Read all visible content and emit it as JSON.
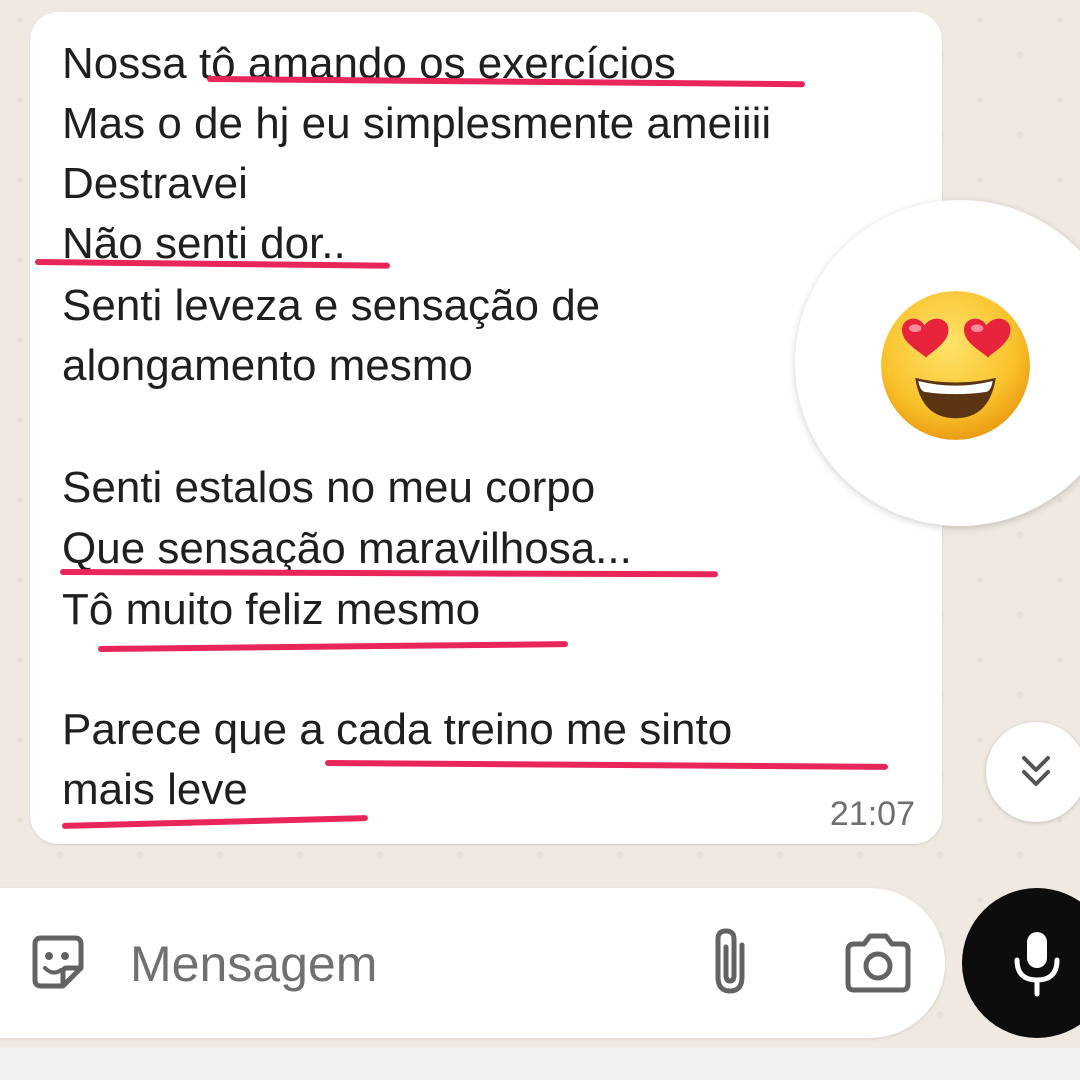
{
  "message": {
    "lines": [
      "Nossa tô amando os exercícios",
      "Mas o de hj eu simplesmente ameiiii",
      "Destravei",
      "Não senti dor..",
      "Senti leveza e sensação de",
      "alongamento mesmo",
      "Senti estalos no meu corpo",
      "Que sensação maravilhosa...",
      "Tô muito feliz mesmo",
      "Parece que a cada treino me sinto",
      "mais leve"
    ],
    "time": "21:07",
    "reaction_icon": "heart-eyes-emoji",
    "highlight_color": "#e8265a"
  },
  "composer": {
    "placeholder": "Mensagem",
    "sticker_icon": "sticker-icon",
    "attach_icon": "paperclip-icon",
    "camera_icon": "camera-icon",
    "mic_icon": "microphone-icon"
  },
  "scroll_down_icon": "double-chevron-down-icon"
}
